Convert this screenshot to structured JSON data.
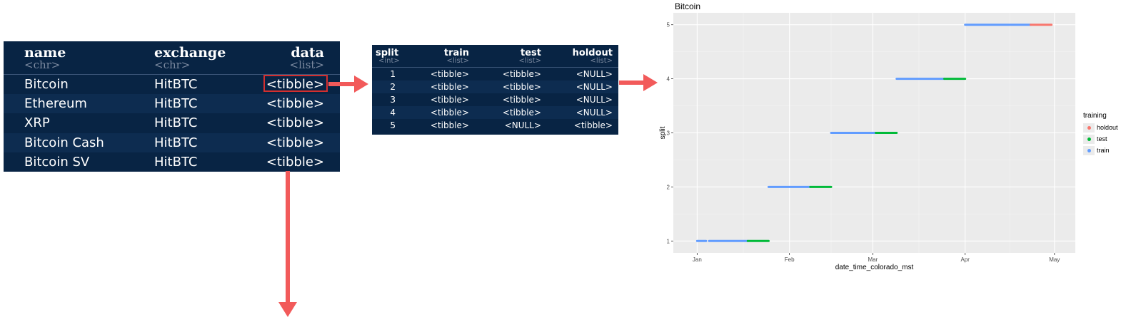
{
  "table1": {
    "columns": [
      {
        "name": "name",
        "type": "<chr>"
      },
      {
        "name": "exchange",
        "type": "<chr>"
      },
      {
        "name": "data",
        "type": "<list>"
      }
    ],
    "rows": [
      [
        "Bitcoin",
        "HitBTC",
        "<tibble>"
      ],
      [
        "Ethereum",
        "HitBTC",
        "<tibble>"
      ],
      [
        "XRP",
        "HitBTC",
        "<tibble>"
      ],
      [
        "Bitcoin Cash",
        "HitBTC",
        "<tibble>"
      ],
      [
        "Bitcoin SV",
        "HitBTC",
        "<tibble>"
      ]
    ]
  },
  "table2": {
    "columns": [
      {
        "name": "split",
        "type": "<int>"
      },
      {
        "name": "train",
        "type": "<list>"
      },
      {
        "name": "test",
        "type": "<list>"
      },
      {
        "name": "holdout",
        "type": "<list>"
      }
    ],
    "rows": [
      [
        "1",
        "<tibble>",
        "<tibble>",
        "<NULL>"
      ],
      [
        "2",
        "<tibble>",
        "<tibble>",
        "<NULL>"
      ],
      [
        "3",
        "<tibble>",
        "<tibble>",
        "<NULL>"
      ],
      [
        "4",
        "<tibble>",
        "<tibble>",
        "<NULL>"
      ],
      [
        "5",
        "<tibble>",
        "<NULL>",
        "<tibble>"
      ]
    ]
  },
  "colors": {
    "table_bg": "#082444",
    "highlight": "#d32f2f",
    "arrow": "#f25a5a",
    "train": "#619cff",
    "test": "#00ba38",
    "holdout": "#f8766d"
  },
  "chart_data": {
    "type": "line",
    "title": "Bitcoin",
    "xlabel": "date_time_colorado_mst",
    "ylabel": "split",
    "x_ticks": [
      "Jan",
      "Feb",
      "Mar",
      "Apr",
      "May"
    ],
    "y_ticks": [
      "1",
      "2",
      "3",
      "4",
      "5"
    ],
    "legend_title": "training",
    "legend": [
      "holdout",
      "test",
      "train"
    ],
    "legend_position": "right",
    "segments": [
      {
        "split": 1,
        "training": "train",
        "start": "2019-01-01",
        "end": "2019-01-04"
      },
      {
        "split": 1,
        "training": "train",
        "start": "2019-01-05",
        "end": "2019-01-18"
      },
      {
        "split": 1,
        "training": "test",
        "start": "2019-01-18",
        "end": "2019-01-25"
      },
      {
        "split": 2,
        "training": "train",
        "start": "2019-01-25",
        "end": "2019-02-08"
      },
      {
        "split": 2,
        "training": "test",
        "start": "2019-02-08",
        "end": "2019-02-15"
      },
      {
        "split": 3,
        "training": "train",
        "start": "2019-02-15",
        "end": "2019-03-02"
      },
      {
        "split": 3,
        "training": "test",
        "start": "2019-03-02",
        "end": "2019-03-09"
      },
      {
        "split": 4,
        "training": "train",
        "start": "2019-03-09",
        "end": "2019-03-25"
      },
      {
        "split": 4,
        "training": "test",
        "start": "2019-03-25",
        "end": "2019-04-01"
      },
      {
        "split": 5,
        "training": "train",
        "start": "2019-04-01",
        "end": "2019-04-23"
      },
      {
        "split": 5,
        "training": "holdout",
        "start": "2019-04-23",
        "end": "2019-04-30"
      }
    ]
  }
}
